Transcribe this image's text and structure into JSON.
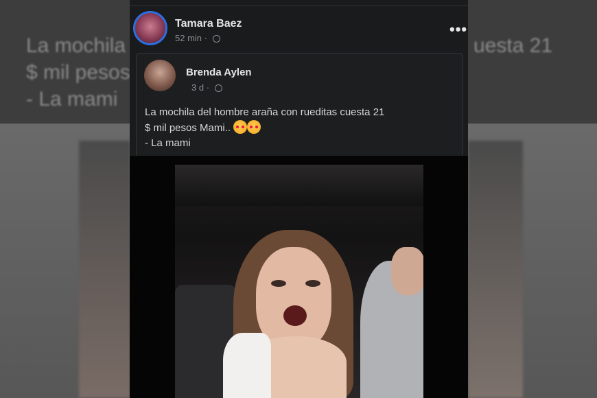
{
  "background": {
    "line1_left": "La mochila",
    "line1_right": "uesta 21",
    "line2_left": "$ mil pesos",
    "line3_left": "- La mami"
  },
  "post": {
    "author": "Tamara Baez",
    "time": "52 min",
    "more_label": "•••"
  },
  "shared": {
    "author": "Brenda Aylen",
    "time": "3 d",
    "text_line1": "La mochila del hombre araña con rueditas cuesta 21",
    "text_line2": "$ mil pesos Mami..",
    "text_line3": "- La mami"
  },
  "colors": {
    "accent": "#2d6fe0",
    "panel": "#1a1b1d",
    "text": "#e6e6e6",
    "muted": "#8b8d91"
  },
  "icons": [
    "globe-icon",
    "more-options-icon",
    "emoji-smiling-hearts-icon"
  ]
}
